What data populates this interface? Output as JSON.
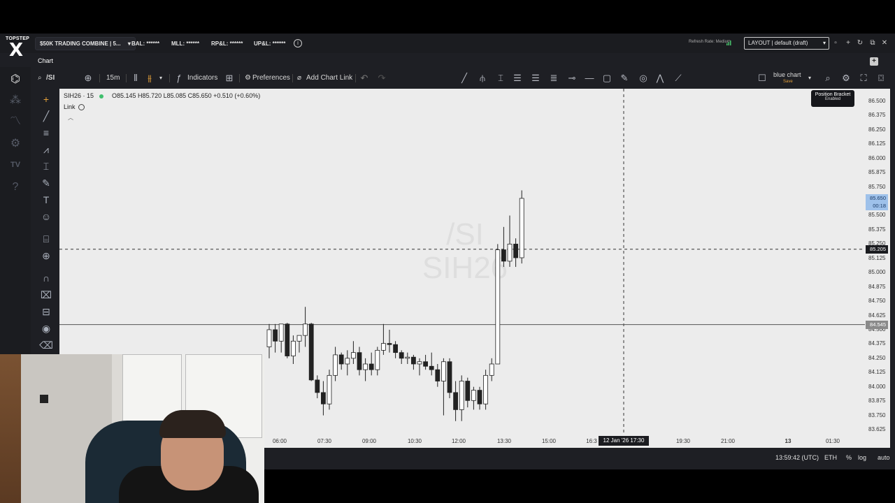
{
  "topbar": {
    "logo_line1": "TOPSTEP",
    "logo_line2": "X",
    "account": "$50K TRADING COMBINE | 5...",
    "bal": "BAL: ******",
    "mll": "MLL: ******",
    "rpl": "RP&L: ******",
    "upl": "UP&L: ******",
    "refresh_rate": "Refresh Rate: Medium",
    "layout": "LAYOUT | default (draft)"
  },
  "chart_panel": {
    "tab": "Chart",
    "search": "/SI",
    "timeframe": "15m",
    "indicators": "Indicators",
    "preferences": "Preferences",
    "add_chart_link": "Add Chart Link",
    "template_name": "blue chart",
    "template_save": "Save"
  },
  "legend": {
    "symbol": "SIH26 · 15",
    "ohlc": "O85.145  H85.720  L85.085  C85.650  +0.510 (+0.60%)",
    "link": "Link"
  },
  "watermark": {
    "line1": "/SI",
    "line2": "SIH26"
  },
  "position_bracket": {
    "title": "Position Bracket",
    "status": "Enabled"
  },
  "price_labels": {
    "last": "85.650",
    "countdown": "00:18",
    "crosshair": "85.205",
    "hline": "84.545"
  },
  "crosshair_time": "12 Jan '26  17:30",
  "bottom": {
    "clock": "13:59:42 (UTC)",
    "session": "ETH",
    "percent": "%",
    "log": "log",
    "auto": "auto"
  },
  "chart_data": {
    "type": "candlestick",
    "symbol": "SIH26",
    "interval": "15m",
    "ylim": [
      83.625,
      86.5
    ],
    "y_ticks": [
      "86.500",
      "86.375",
      "86.250",
      "86.125",
      "86.000",
      "85.875",
      "85.750",
      "85.625",
      "85.500",
      "85.375",
      "85.250",
      "85.125",
      "85.000",
      "84.875",
      "84.750",
      "84.625",
      "84.500",
      "84.375",
      "84.250",
      "84.125",
      "84.000",
      "83.875",
      "83.750",
      "83.625"
    ],
    "x_ticks": [
      "06:00",
      "07:30",
      "09:00",
      "10:30",
      "12:00",
      "13:30",
      "15:00",
      "16:3",
      "19:30",
      "21:00",
      "13",
      "01:30"
    ],
    "horizontal_line": 84.545,
    "crosshair_price": 85.205,
    "candles": [
      {
        "o": 84.35,
        "h": 84.55,
        "l": 84.25,
        "c": 84.5
      },
      {
        "o": 84.5,
        "h": 84.55,
        "l": 84.3,
        "c": 84.4
      },
      {
        "o": 84.4,
        "h": 84.55,
        "l": 84.3,
        "c": 84.55
      },
      {
        "o": 84.55,
        "h": 84.56,
        "l": 84.25,
        "c": 84.27
      },
      {
        "o": 84.27,
        "h": 84.45,
        "l": 84.2,
        "c": 84.4
      },
      {
        "o": 84.4,
        "h": 84.45,
        "l": 84.3,
        "c": 84.45
      },
      {
        "o": 84.45,
        "h": 84.7,
        "l": 84.35,
        "c": 84.55
      },
      {
        "o": 84.55,
        "h": 84.56,
        "l": 84.05,
        "c": 84.06
      },
      {
        "o": 84.06,
        "h": 84.1,
        "l": 83.9,
        "c": 83.95
      },
      {
        "o": 83.95,
        "h": 84.05,
        "l": 83.75,
        "c": 83.85
      },
      {
        "o": 83.85,
        "h": 84.15,
        "l": 83.8,
        "c": 84.1
      },
      {
        "o": 84.1,
        "h": 84.35,
        "l": 84.05,
        "c": 84.28
      },
      {
        "o": 84.28,
        "h": 84.3,
        "l": 84.15,
        "c": 84.2
      },
      {
        "o": 84.2,
        "h": 84.32,
        "l": 84.1,
        "c": 84.25
      },
      {
        "o": 84.25,
        "h": 84.4,
        "l": 84.2,
        "c": 84.3
      },
      {
        "o": 84.3,
        "h": 84.35,
        "l": 84.1,
        "c": 84.15
      },
      {
        "o": 84.15,
        "h": 84.25,
        "l": 84.05,
        "c": 84.2
      },
      {
        "o": 84.2,
        "h": 84.3,
        "l": 84.1,
        "c": 84.15
      },
      {
        "o": 84.15,
        "h": 84.35,
        "l": 84.1,
        "c": 84.32
      },
      {
        "o": 84.32,
        "h": 84.55,
        "l": 84.28,
        "c": 84.38
      },
      {
        "o": 84.38,
        "h": 84.5,
        "l": 84.3,
        "c": 84.37
      },
      {
        "o": 84.37,
        "h": 84.4,
        "l": 84.25,
        "c": 84.3
      },
      {
        "o": 84.3,
        "h": 84.32,
        "l": 84.2,
        "c": 84.25
      },
      {
        "o": 84.25,
        "h": 84.3,
        "l": 84.2,
        "c": 84.26
      },
      {
        "o": 84.26,
        "h": 84.28,
        "l": 84.15,
        "c": 84.2
      },
      {
        "o": 84.2,
        "h": 84.25,
        "l": 84.1,
        "c": 84.22
      },
      {
        "o": 84.22,
        "h": 84.28,
        "l": 84.15,
        "c": 84.18
      },
      {
        "o": 84.18,
        "h": 84.3,
        "l": 84.1,
        "c": 84.15
      },
      {
        "o": 84.15,
        "h": 84.2,
        "l": 84.0,
        "c": 84.05
      },
      {
        "o": 84.05,
        "h": 84.25,
        "l": 83.75,
        "c": 84.22
      },
      {
        "o": 84.22,
        "h": 84.25,
        "l": 83.9,
        "c": 83.95
      },
      {
        "o": 83.95,
        "h": 84.05,
        "l": 83.7,
        "c": 83.8
      },
      {
        "o": 83.8,
        "h": 84.1,
        "l": 83.7,
        "c": 84.05
      },
      {
        "o": 84.05,
        "h": 84.08,
        "l": 83.82,
        "c": 83.88
      },
      {
        "o": 83.88,
        "h": 84.0,
        "l": 83.8,
        "c": 83.97
      },
      {
        "o": 83.97,
        "h": 84.0,
        "l": 83.8,
        "c": 83.85
      },
      {
        "o": 83.85,
        "h": 84.15,
        "l": 83.8,
        "c": 84.1
      },
      {
        "o": 84.1,
        "h": 84.25,
        "l": 84.05,
        "c": 84.2
      },
      {
        "o": 84.2,
        "h": 85.25,
        "l": 84.2,
        "c": 85.2
      },
      {
        "o": 85.2,
        "h": 85.4,
        "l": 85.05,
        "c": 85.1
      },
      {
        "o": 85.1,
        "h": 85.5,
        "l": 85.05,
        "c": 85.25
      },
      {
        "o": 85.25,
        "h": 85.3,
        "l": 85.05,
        "c": 85.13
      },
      {
        "o": 85.13,
        "h": 85.72,
        "l": 85.08,
        "c": 85.65
      }
    ]
  }
}
